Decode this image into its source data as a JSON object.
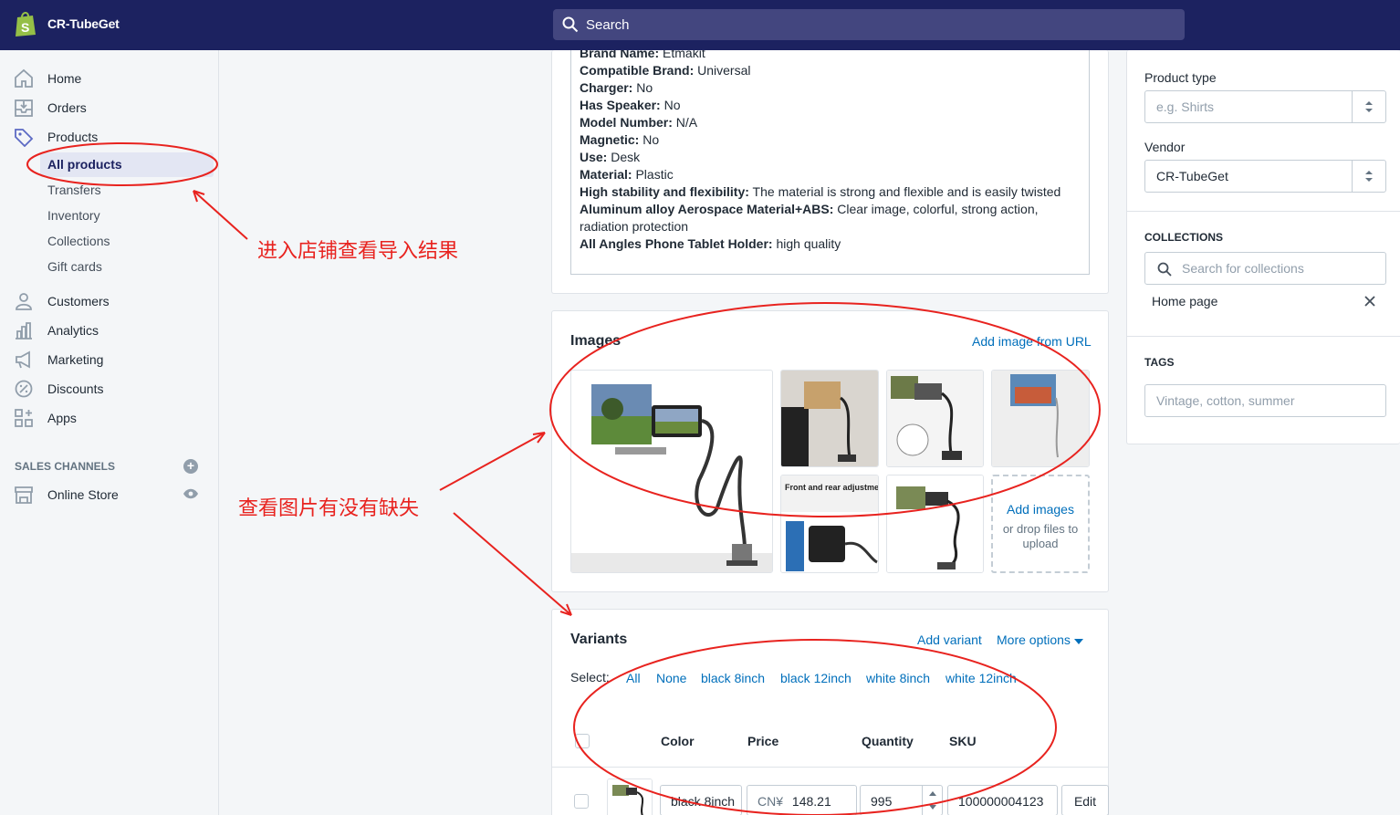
{
  "topbar": {
    "store_name": "CR-TubeGet",
    "search_placeholder": "Search"
  },
  "sidebar": {
    "items": [
      {
        "label": "Home",
        "icon": "home-icon"
      },
      {
        "label": "Orders",
        "icon": "orders-icon"
      },
      {
        "label": "Products",
        "icon": "tag-icon"
      }
    ],
    "product_subitems": [
      "All products",
      "Transfers",
      "Inventory",
      "Collections",
      "Gift cards"
    ],
    "items2": [
      {
        "label": "Customers",
        "icon": "person-icon"
      },
      {
        "label": "Analytics",
        "icon": "bar-chart-icon"
      },
      {
        "label": "Marketing",
        "icon": "megaphone-icon"
      },
      {
        "label": "Discounts",
        "icon": "discount-icon"
      },
      {
        "label": "Apps",
        "icon": "apps-icon"
      }
    ],
    "sales_channels_title": "SALES CHANNELS",
    "online_store": "Online Store"
  },
  "description": [
    {
      "k": "Brand Name:",
      "v": " Etmakit"
    },
    {
      "k": "Compatible Brand:",
      "v": " Universal"
    },
    {
      "k": "Charger:",
      "v": " No"
    },
    {
      "k": "Has Speaker:",
      "v": " No"
    },
    {
      "k": "Model Number:",
      "v": " N/A"
    },
    {
      "k": "Magnetic:",
      "v": " No"
    },
    {
      "k": "Use:",
      "v": " Desk"
    },
    {
      "k": "Material:",
      "v": " Plastic"
    },
    {
      "k": "High stability and flexibility:",
      "v": " The material is strong and flexible and is easily twisted"
    },
    {
      "k": "Aluminum alloy Aerospace Material+ABS:",
      "v": " Clear image, colorful, strong action, radiation protection"
    },
    {
      "k": "All Angles Phone Tablet Holder:",
      "v": " high quality"
    }
  ],
  "images": {
    "title": "Images",
    "add_url": "Add image from URL",
    "tile_caption": "Front and rear adjustment",
    "add_images": "Add images",
    "drop_hint": "or drop files to upload"
  },
  "variants": {
    "title": "Variants",
    "add_variant": "Add variant",
    "more_options": "More options",
    "select_label": "Select:",
    "filters": [
      "All",
      "None",
      "black 8inch",
      "black 12inch",
      "white 8inch",
      "white 12inch"
    ],
    "columns": {
      "color": "Color",
      "price": "Price",
      "quantity": "Quantity",
      "sku": "SKU"
    },
    "row": {
      "color": "black  8inch",
      "currency": "CN¥",
      "price": "148.21",
      "quantity": "995",
      "sku": "100000004123",
      "edit": "Edit"
    }
  },
  "right": {
    "product_type_label": "Product type",
    "product_type_placeholder": "e.g. Shirts",
    "vendor_label": "Vendor",
    "vendor_value": "CR-TubeGet",
    "collections_head": "COLLECTIONS",
    "collections_placeholder": "Search for collections",
    "collection_item": "Home page",
    "tags_head": "TAGS",
    "tags_placeholder": "Vintage, cotton, summer"
  },
  "annotations": {
    "note1": "进入店铺查看导入结果",
    "note2": "查看图片有没有缺失"
  },
  "colors": {
    "topbar": "#1c2260",
    "link": "#006fbb",
    "annotation": "#e8231f"
  }
}
